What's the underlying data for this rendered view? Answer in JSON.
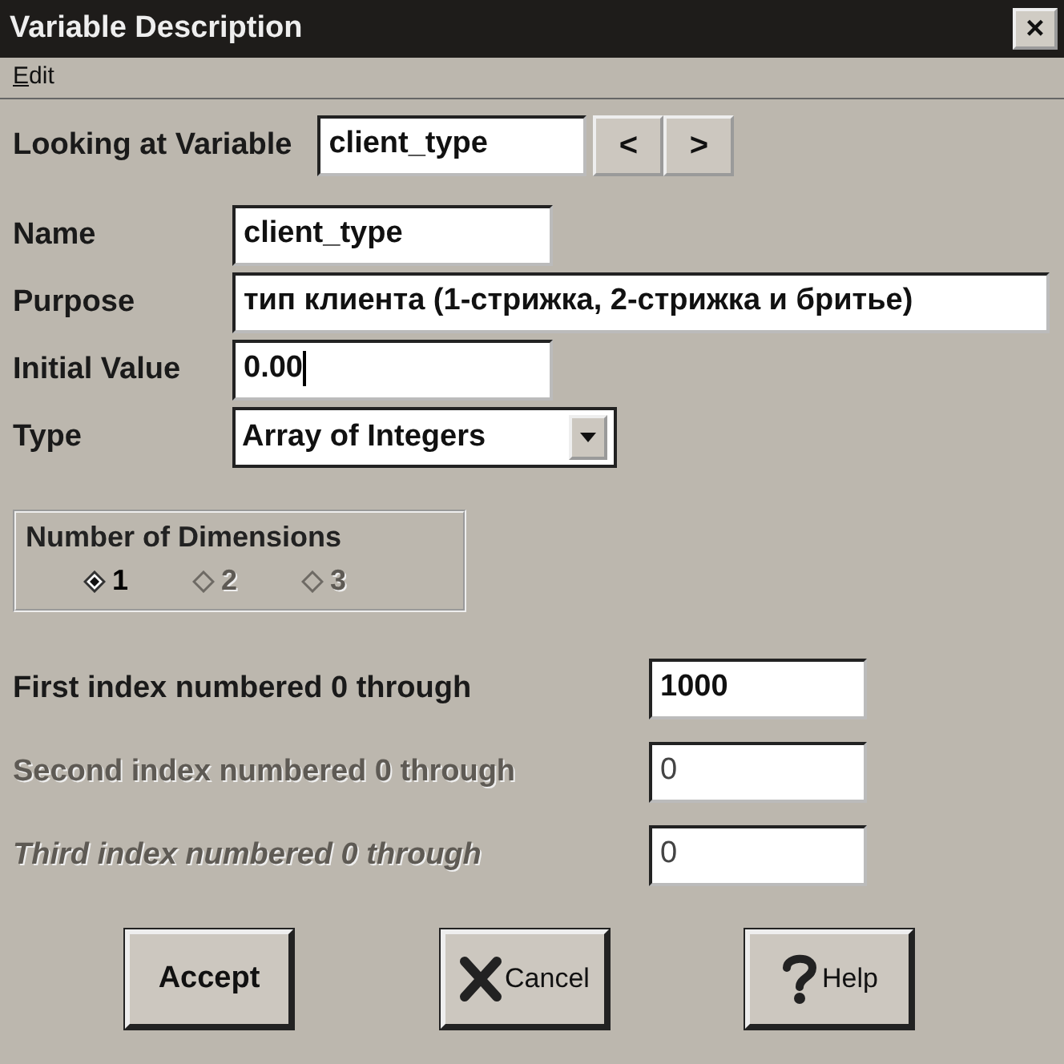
{
  "window": {
    "title": "Variable Description",
    "close": "×"
  },
  "menu": [
    {
      "label": "Edit"
    }
  ],
  "looking_at": {
    "label": "Looking at Variable",
    "value": "client_type",
    "prev": "<",
    "next": ">"
  },
  "fields": [
    {
      "kind": "text",
      "label": "Name",
      "value": "client_type"
    },
    {
      "kind": "text",
      "label": "Purpose",
      "value": "тип клиента (1-стрижка, 2-стрижка и бритье)"
    },
    {
      "kind": "text",
      "label": "Initial Value",
      "value": "0.00",
      "caret": true
    },
    {
      "kind": "select",
      "label": "Type",
      "value": "Array of Integers"
    }
  ],
  "dimensions": {
    "title": "Number of Dimensions",
    "options": [
      {
        "label": "1",
        "selected": true,
        "disabled": false
      },
      {
        "label": "2",
        "selected": false,
        "disabled": true
      },
      {
        "label": "3",
        "selected": false,
        "disabled": true
      }
    ]
  },
  "indexes": [
    {
      "label": "First index numbered 0 through",
      "value": "1000",
      "disabled": false
    },
    {
      "label": "Second index numbered 0 through",
      "value": "0",
      "disabled": true
    },
    {
      "label": "Third index numbered 0 through",
      "value": "0",
      "disabled": true
    }
  ],
  "buttons": [
    {
      "kind": "accept",
      "label": "Accept"
    },
    {
      "kind": "cancel",
      "label": "Cancel"
    },
    {
      "kind": "help",
      "label": "Help"
    }
  ]
}
